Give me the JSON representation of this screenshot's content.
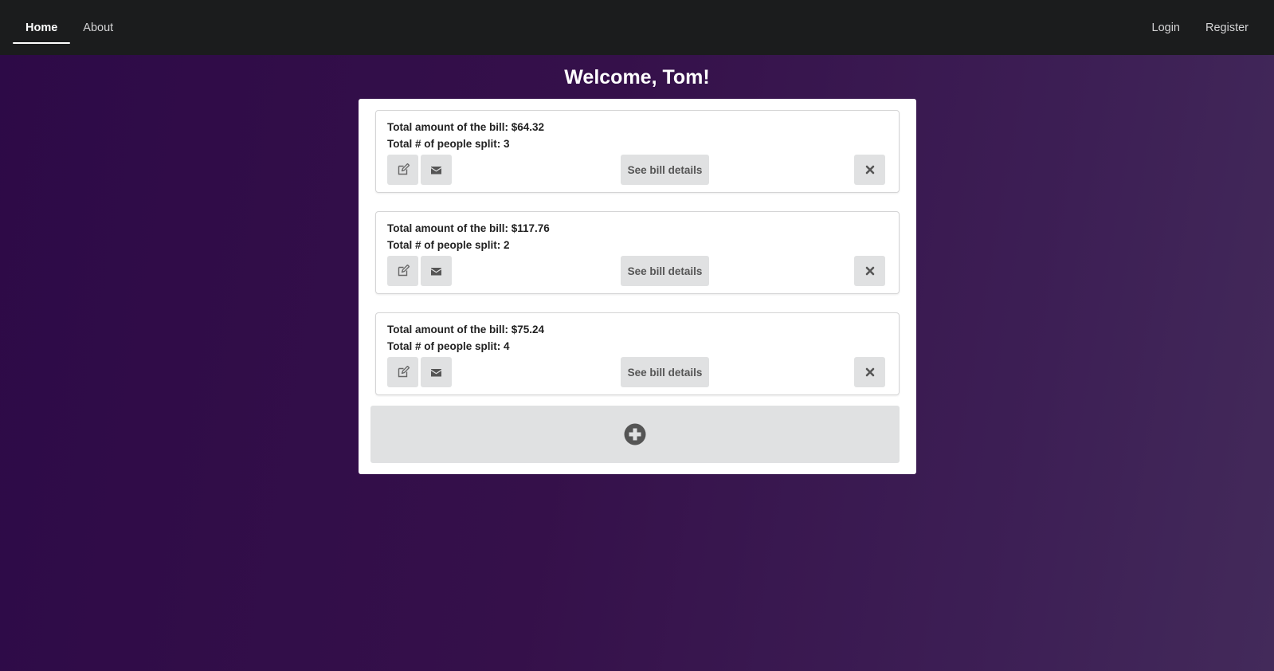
{
  "nav": {
    "left": [
      {
        "label": "Home",
        "active": true
      },
      {
        "label": "About",
        "active": false
      }
    ],
    "right": [
      {
        "label": "Login"
      },
      {
        "label": "Register"
      }
    ]
  },
  "welcome": "Welcome, Tom!",
  "bills": [
    {
      "amount_label": "Total amount of the bill: ",
      "amount": "$64.32",
      "people_label": "Total # of people split: ",
      "people": "3",
      "details_label": "See bill details"
    },
    {
      "amount_label": "Total amount of the bill: ",
      "amount": "$117.76",
      "people_label": "Total # of people split: ",
      "people": "2",
      "details_label": "See bill details"
    },
    {
      "amount_label": "Total amount of the bill: ",
      "amount": "$75.24",
      "people_label": "Total # of people split: ",
      "people": "4",
      "details_label": "See bill details"
    }
  ],
  "icons": {
    "edit": "edit-icon",
    "mail": "mail-icon",
    "delete": "close-icon",
    "add": "plus-circle-icon"
  },
  "colors": {
    "navbar": "#1b1c1d",
    "button": "#e0e1e2",
    "icon": "#555555",
    "background_start": "#2d0a47",
    "background_end": "#432a5a"
  }
}
